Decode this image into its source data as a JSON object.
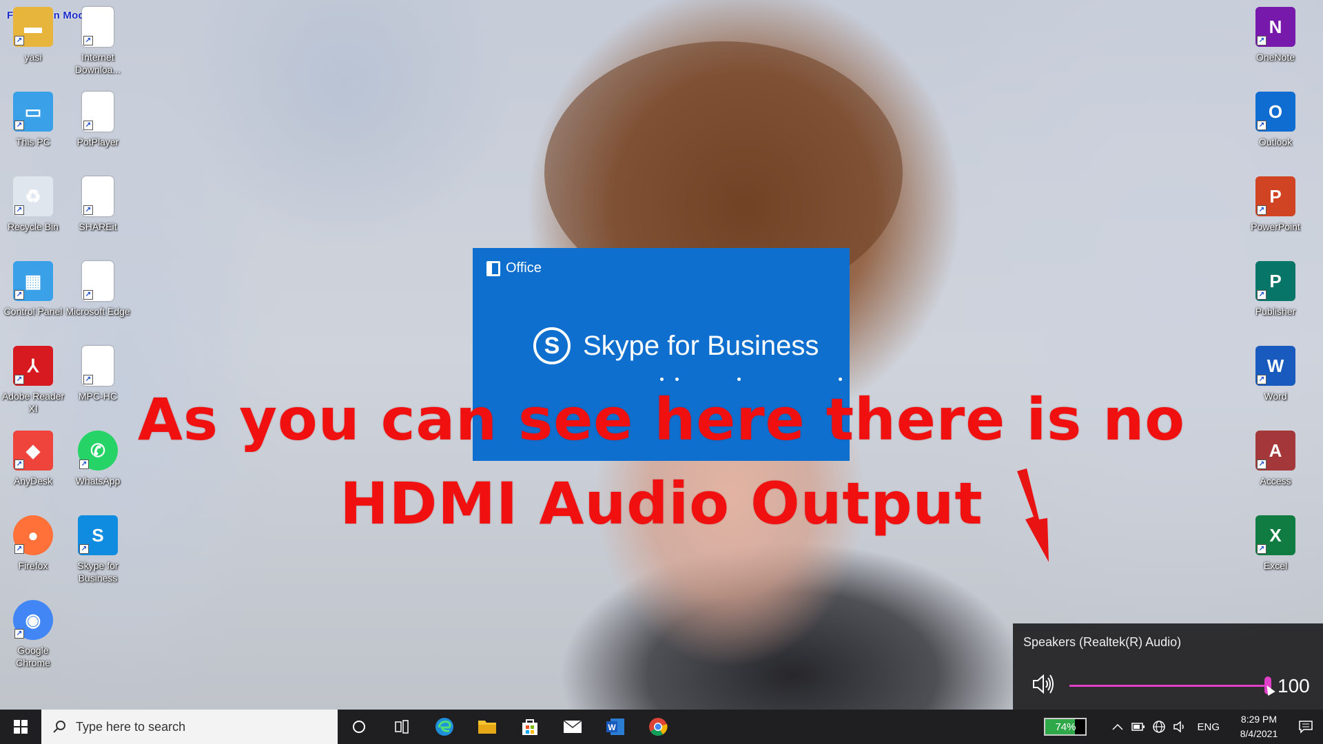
{
  "overlay": {
    "fullscreen_mode": "Fullscreen Mode",
    "caption_line1": "As you can see here there is no",
    "caption_line2": "HDMI Audio Output"
  },
  "desktop": {
    "left_icons": [
      {
        "label": "yasi",
        "icon": "folder-icon",
        "color": "#e8b53c"
      },
      {
        "label": "Internet Downloa...",
        "icon": "document-shortcut-icon",
        "color": "#ffffff"
      },
      {
        "label": "This PC",
        "icon": "computer-icon",
        "color": "#3aa0e8"
      },
      {
        "label": "PotPlayer",
        "icon": "document-shortcut-icon",
        "color": "#ffffff"
      },
      {
        "label": "Recycle Bin",
        "icon": "recycle-bin-icon",
        "color": "#dfe6ee"
      },
      {
        "label": "SHAREit",
        "icon": "document-shortcut-icon",
        "color": "#ffffff"
      },
      {
        "label": "Control Panel",
        "icon": "control-panel-icon",
        "color": "#3aa0e8"
      },
      {
        "label": "Microsoft Edge",
        "icon": "document-shortcut-icon",
        "color": "#ffffff"
      },
      {
        "label": "Adobe Reader XI",
        "icon": "adobe-reader-icon",
        "color": "#d71920"
      },
      {
        "label": "MPC-HC",
        "icon": "document-shortcut-icon",
        "color": "#ffffff"
      },
      {
        "label": "AnyDesk",
        "icon": "anydesk-icon",
        "color": "#ef443b"
      },
      {
        "label": "WhatsApp",
        "icon": "whatsapp-icon",
        "color": "#25d366"
      },
      {
        "label": "Firefox",
        "icon": "firefox-icon",
        "color": "#ff7139"
      },
      {
        "label": "Skype for Business",
        "icon": "skype-icon",
        "color": "#0f8be0"
      },
      {
        "label": "Google Chrome",
        "icon": "chrome-icon",
        "color": "#4285f4"
      }
    ],
    "right_icons": [
      {
        "label": "OneNote",
        "letter": "N",
        "icon": "onenote-icon",
        "color": "#7719aa"
      },
      {
        "label": "Outlook",
        "letter": "O",
        "icon": "outlook-icon",
        "color": "#0f6cd0"
      },
      {
        "label": "PowerPoint",
        "letter": "P",
        "icon": "powerpoint-icon",
        "color": "#d04423"
      },
      {
        "label": "Publisher",
        "letter": "P",
        "icon": "publisher-icon",
        "color": "#077568"
      },
      {
        "label": "Word",
        "letter": "W",
        "icon": "word-icon",
        "color": "#185abd"
      },
      {
        "label": "Access",
        "letter": "A",
        "icon": "access-icon",
        "color": "#a4373a"
      },
      {
        "label": "Excel",
        "letter": "X",
        "icon": "excel-icon",
        "color": "#107c41"
      }
    ]
  },
  "splash": {
    "brand": "Office",
    "product": "Skype for Business",
    "logo_letter": "S",
    "color": "#0f6fcf"
  },
  "volume": {
    "device": "Speakers (Realtek(R) Audio)",
    "level": 100,
    "level_text": "100",
    "accent": "#e040c8"
  },
  "taskbar": {
    "search_placeholder": "Type here to search",
    "pinned": [
      "cortana-icon",
      "task-view-icon",
      "edge-icon",
      "file-explorer-icon",
      "store-icon",
      "mail-icon",
      "word-icon",
      "chrome-icon"
    ],
    "battery_percent": 74,
    "battery_text": "74%",
    "language": "ENG",
    "time": "8:29 PM",
    "date": "8/4/2021"
  }
}
